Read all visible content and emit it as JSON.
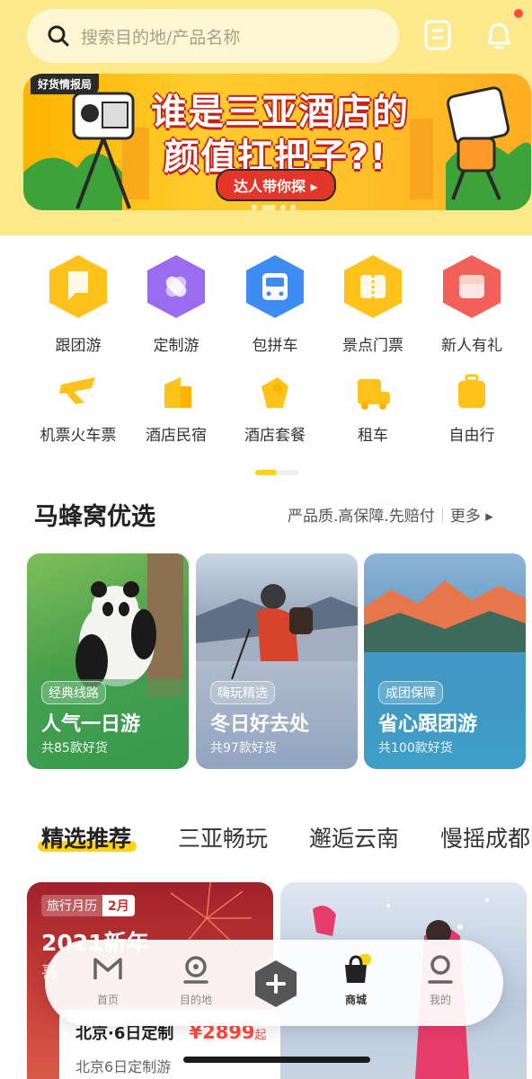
{
  "search": {
    "placeholder": "搜索目的地/产品名称",
    "icon": "search-icon"
  },
  "header": {
    "doc_icon": "document-icon",
    "bell_icon": "bell-icon"
  },
  "banner": {
    "tag": "好货情报局",
    "line1": "谁是三亚酒店的",
    "line2": "颜值扛把子?!",
    "cta": "达人带你探 ▸"
  },
  "categories": [
    {
      "label": "跟团游",
      "icon": "flag-icon",
      "color": "#ffc21a"
    },
    {
      "label": "定制游",
      "icon": "custom-icon",
      "color": "#9a6cf0"
    },
    {
      "label": "包拼车",
      "icon": "bus-icon",
      "color": "#3c8cf2"
    },
    {
      "label": "景点门票",
      "icon": "ticket-icon",
      "color": "#ffc21a"
    },
    {
      "label": "新人有礼",
      "icon": "gift-icon",
      "color": "#f2605a"
    },
    {
      "label": "机票火车票",
      "icon": "plane-icon",
      "color": "#ffc21a"
    },
    {
      "label": "酒店民宿",
      "icon": "hotel-icon",
      "color": "#ffc21a"
    },
    {
      "label": "酒店套餐",
      "icon": "package-icon",
      "color": "#ffc21a"
    },
    {
      "label": "租车",
      "icon": "car-icon",
      "color": "#ffc21a"
    },
    {
      "label": "自由行",
      "icon": "suitcase-icon",
      "color": "#ffc21a"
    }
  ],
  "picks": {
    "title": "马蜂窝优选",
    "subtitle": "严品质.高保障.先赔付",
    "more": "更多 ▸",
    "cards": [
      {
        "badge": "经典线路",
        "title": "人气一日游",
        "count": "共85款好货"
      },
      {
        "badge": "嗨玩精选",
        "title": "冬日好去处",
        "count": "共97款好货"
      },
      {
        "badge": "成团保障",
        "title": "省心跟团游",
        "count": "共100款好货"
      }
    ]
  },
  "tabs": [
    "精选推荐",
    "三亚畅玩",
    "邂逅云南",
    "慢摇成都"
  ],
  "products": [
    {
      "cal_a": "旅行月历",
      "cal_b": "2月",
      "headline": "2021新年",
      "headline2": "喜",
      "name": "北京·6日定制",
      "price": "¥2899",
      "unit": "起",
      "sub": "北京6日定制游"
    }
  ],
  "nav": [
    {
      "label": "首页",
      "icon": "home-icon"
    },
    {
      "label": "目的地",
      "icon": "location-icon"
    },
    {
      "label": "",
      "icon": "plus-icon"
    },
    {
      "label": "商城",
      "icon": "shop-bag-icon"
    },
    {
      "label": "我的",
      "icon": "profile-icon"
    }
  ]
}
